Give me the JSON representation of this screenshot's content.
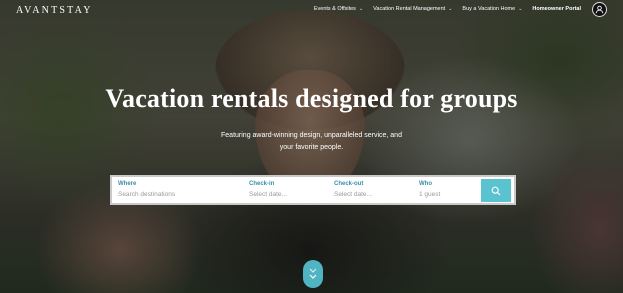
{
  "brand": {
    "logo_text": "AVANTSTAY"
  },
  "nav": {
    "items": [
      {
        "label": "Events & Offsites",
        "has_dropdown": true
      },
      {
        "label": "Vacation Rental Management",
        "has_dropdown": true
      },
      {
        "label": "Buy a Vacation Home",
        "has_dropdown": true
      },
      {
        "label": "Homeowner Portal",
        "has_dropdown": false
      }
    ],
    "account_icon": "user-circle-icon"
  },
  "hero": {
    "headline": "Vacation rentals designed for groups",
    "subhead_line1": "Featuring award-winning design, unparalleled service, and",
    "subhead_line2": "your favorite people."
  },
  "search": {
    "where": {
      "label": "Where",
      "placeholder": "Search destinations"
    },
    "checkin": {
      "label": "Check-in",
      "placeholder": "Select date..."
    },
    "checkout": {
      "label": "Check-out",
      "placeholder": "Select date..."
    },
    "who": {
      "label": "Who",
      "value": "1 guest"
    },
    "button_icon": "search-icon"
  },
  "scroll": {
    "icon": "chevron-down-icon"
  },
  "colors": {
    "accent": "#5bc3cf",
    "label": "#3a8fa8",
    "text_light": "#ffffff"
  }
}
